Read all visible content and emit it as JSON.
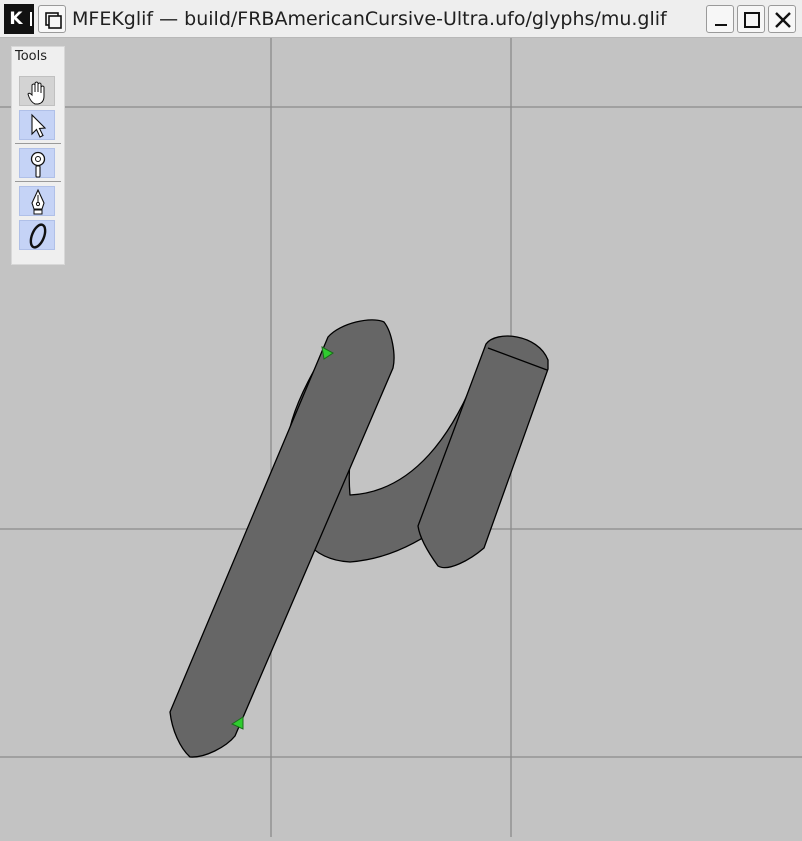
{
  "window": {
    "app_icon_letter": "K",
    "title": "MFEKglif — build/FRBAmericanCursive-Ultra.ufo/glyphs/mu.glif",
    "buttons": [
      "keep-above",
      "minimize",
      "maximize",
      "close"
    ]
  },
  "toolbox": {
    "label": "Tools",
    "tools": [
      {
        "name": "pan",
        "icon": "hand-icon",
        "selected": false
      },
      {
        "name": "select",
        "icon": "pointer-arrow-icon",
        "selected": true
      },
      {
        "name": "zoom",
        "icon": "magnifier-icon",
        "selected": true
      },
      {
        "name": "pen",
        "icon": "pen-nib-icon",
        "selected": true
      },
      {
        "name": "ellipse",
        "icon": "ellipse-icon",
        "selected": true
      }
    ]
  },
  "canvas": {
    "background": "#c3c3c3",
    "grid_color": "#8c8c8c",
    "glyph_fill": "#666666",
    "glyph_stroke": "#000000",
    "handle_color": "#2fcc2f",
    "glyph_name": "mu"
  }
}
